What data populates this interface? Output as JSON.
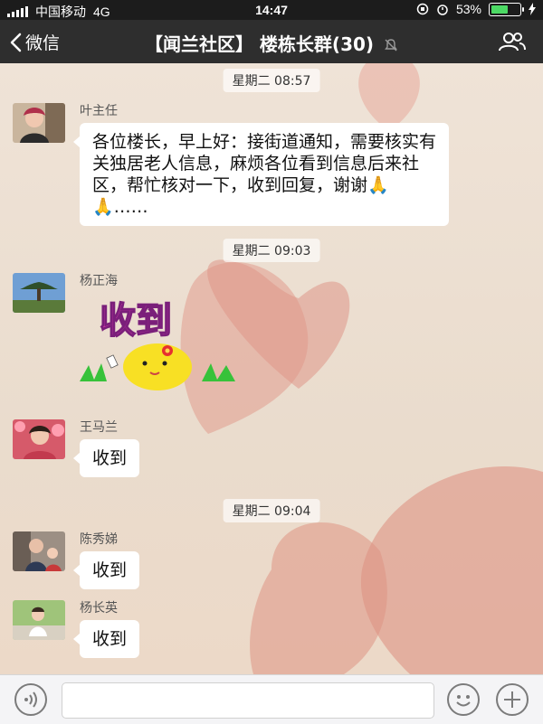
{
  "status_bar": {
    "carrier": "中国移动",
    "network": "4G",
    "time": "14:47",
    "battery_percent": "53%",
    "battery_level": 0.53
  },
  "nav": {
    "back_label": "微信",
    "title": "【闻兰社区】 楼栋长群(30)"
  },
  "chat": {
    "timestamps": [
      "星期二 08:57",
      "星期二 09:03",
      "星期二 09:04"
    ],
    "messages": [
      {
        "sender": "叶主任",
        "text": "各位楼长，早上好：接街道通知，需要核实有关独居老人信息，麻烦各位看到信息后来社区，帮忙核对一下，收到回复，谢谢🙏🙏……"
      },
      {
        "sender": "杨正海",
        "sticker_text": "收到"
      },
      {
        "sender": "王马兰",
        "text": "收到"
      },
      {
        "sender": "陈秀娣",
        "text": "收到"
      },
      {
        "sender": "杨长英",
        "text": "收到"
      }
    ]
  },
  "colors": {
    "navbar": "#2e2e2e",
    "statusbar": "#1c1c1c",
    "heart": "#e2988a",
    "bubble": "#ffffff"
  },
  "icons": [
    "back-chevron-icon",
    "mute-bell-icon",
    "group-members-icon",
    "voice-icon",
    "emoji-icon",
    "plus-icon"
  ]
}
